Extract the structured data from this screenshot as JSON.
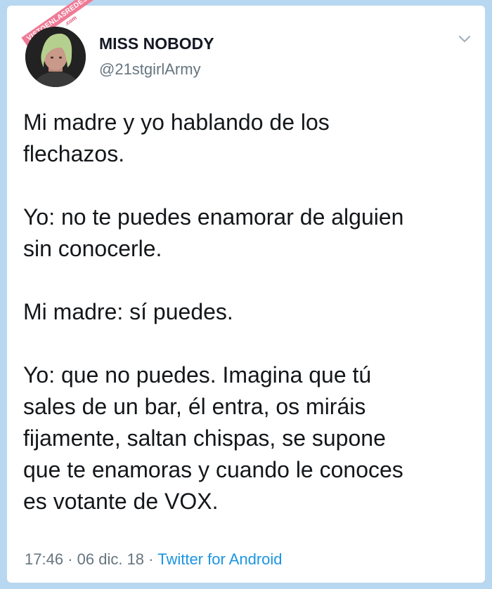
{
  "watermark": {
    "text": "VISTOENLASREDES",
    "suffix": ".com"
  },
  "tweet": {
    "display_name": "MISS NOBODY",
    "username": "@21stgirlArmy",
    "text": "Mi madre y yo hablando de los\nflechazos.\n\nYo: no te puedes enamorar de alguien\nsin conocerle.\n\nMi madre: sí puedes.\n\nYo: que no puedes. Imagina que tú\nsales de un bar, él entra, os miráis\nfijamente, saltan chispas, se supone\nque te enamoras y cuando le conoces\nes votante de VOX.",
    "time": "17:46",
    "separator": "·",
    "date": "06 dic. 18",
    "source": "Twitter for Android"
  },
  "icons": {
    "menu": "chevron-down-icon",
    "avatar": "profile-photo"
  },
  "colors": {
    "background": "#b8d7f0",
    "link": "#1b95e0",
    "muted": "#66757f",
    "text": "#14171a"
  }
}
